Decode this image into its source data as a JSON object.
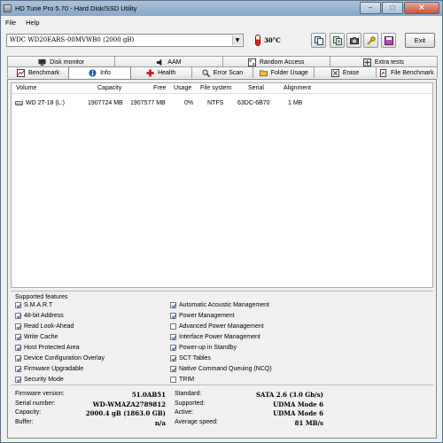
{
  "window": {
    "title": "HD Tune Pro 5.70 - Hard Disk/SSD Utility"
  },
  "menu": {
    "file": "File",
    "help": "Help"
  },
  "toolbar": {
    "drive": "WDC WD20EARS-00MVWB0 (2000 gB)",
    "temperature": "30°C",
    "exit_label": "Exit",
    "icons": [
      "copy-icon",
      "copy-text-icon",
      "screenshot-icon",
      "options-icon",
      "save-icon"
    ]
  },
  "tabs_top": [
    "Disk monitor",
    "AAM",
    "Random Access",
    "Extra tests"
  ],
  "tabs_bottom": [
    "Benchmark",
    "Info",
    "Health",
    "Error Scan",
    "Folder Usage",
    "Erase",
    "File Benchmark"
  ],
  "active_tab": "Info",
  "volumes": {
    "headers": [
      "Volume",
      "Capacity",
      "Free",
      "Usage",
      "File system",
      "Serial",
      "Alignment"
    ],
    "rows": [
      [
        "WD 2T-18 (L:)",
        "1907724 MB",
        "1907577 MB",
        "0%",
        "NTFS",
        "63DC-6B70",
        "1 MB"
      ]
    ]
  },
  "features": {
    "title": "Supported features",
    "left": [
      {
        "label": "S.M.A.R.T",
        "checked": true
      },
      {
        "label": "48-bit Address",
        "checked": true
      },
      {
        "label": "Read Look-Ahead",
        "checked": true
      },
      {
        "label": "Write Cache",
        "checked": true
      },
      {
        "label": "Host Protected Area",
        "checked": true
      },
      {
        "label": "Device Configuration Overlay",
        "checked": true
      },
      {
        "label": "Firmware Upgradable",
        "checked": true
      },
      {
        "label": "Security Mode",
        "checked": true
      }
    ],
    "right": [
      {
        "label": "Automatic Acoustic Management",
        "checked": true
      },
      {
        "label": "Power Management",
        "checked": true
      },
      {
        "label": "Advanced Power Management",
        "checked": false
      },
      {
        "label": "Interface Power Management",
        "checked": true
      },
      {
        "label": "Power-up in Standby",
        "checked": true
      },
      {
        "label": "SCT Tables",
        "checked": true
      },
      {
        "label": "Native Command Queuing (NCQ)",
        "checked": true
      },
      {
        "label": "TRIM",
        "checked": false
      }
    ]
  },
  "info": {
    "left": [
      {
        "label": "Firmware version:",
        "value": "51.0AB51"
      },
      {
        "label": "Serial number:",
        "value": "WD-WMAZA2789812"
      },
      {
        "label": "Capacity:",
        "value": "2000.4 gB (1863.0 GB)"
      },
      {
        "label": "Buffer:",
        "value": "n/a"
      }
    ],
    "right": [
      {
        "label": "Standard:",
        "value": "SATA 2.6 (3.0 Gb/s)"
      },
      {
        "label": "Supported:",
        "value": "UDMA Mode 6"
      },
      {
        "label": "Active:",
        "value": "UDMA Mode 6"
      },
      {
        "label": "Average speed:",
        "value": "81 MB/s"
      }
    ]
  }
}
